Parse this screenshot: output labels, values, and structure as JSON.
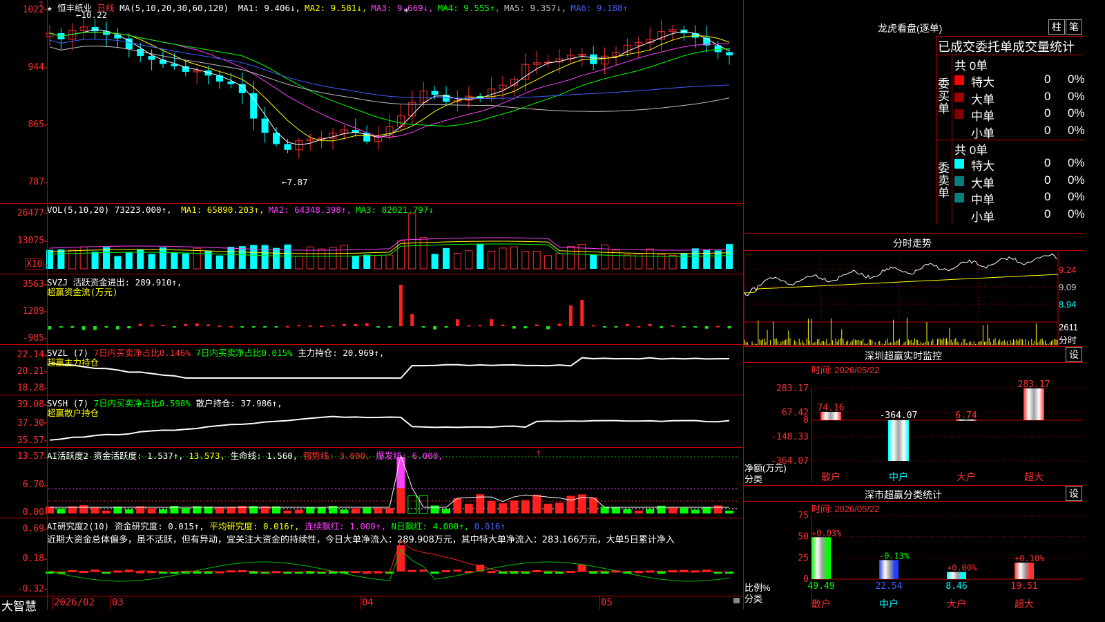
{
  "app": {
    "logo": "大智慧"
  },
  "main": {
    "title": "恒丰纸业",
    "period": "日线",
    "ma_label": "MA(5,10,20,30,60,120)",
    "ma": [
      {
        "name": "MA1:",
        "value": "9.406↓,",
        "color": "#ffffff"
      },
      {
        "name": "MA2:",
        "value": "9.581↓,",
        "color": "#ffff00"
      },
      {
        "name": "MA3:",
        "value": "9.669↓,",
        "color": "#ff40ff"
      },
      {
        "name": "MA4:",
        "value": "9.555↑,",
        "color": "#00ff00"
      },
      {
        "name": "MA5:",
        "value": "9.357↓,",
        "color": "#c0c0c0"
      },
      {
        "name": "MA6:",
        "value": "9.188↑",
        "color": "#4060ff"
      }
    ],
    "y_labels": [
      "1022",
      "944",
      "865",
      "787"
    ],
    "high_label": "10.22",
    "low_label": "7.87",
    "star_mark": "*"
  },
  "vol": {
    "header": "VOL(5,10,20) 73223.000↑,",
    "ma": [
      {
        "name": "MA1:",
        "value": "65890.203↑,",
        "color": "#ffff00"
      },
      {
        "name": "MA2:",
        "value": "64348.398↑,",
        "color": "#ff40ff"
      },
      {
        "name": "MA3:",
        "value": "82021.797↓",
        "color": "#00ff00"
      }
    ],
    "y_labels": [
      "26477",
      "13075"
    ],
    "unit": "X10"
  },
  "svzj": {
    "header": "SVZJ  活跃资金进出: 289.910↑,",
    "sub": "超赢资金流(万元)",
    "y_labels": [
      "3563",
      "1289",
      "-985"
    ]
  },
  "svzl": {
    "header_a": "SVZL (7)",
    "header_b": "7日内买卖净占比0.146%",
    "header_c": "7日内买卖净占比0.015%",
    "header_d": "主力持仓: 20.969↑,",
    "sub": "超赢主力持仓",
    "y_labels": [
      "22.14",
      "20.21",
      "18.28"
    ]
  },
  "svsh": {
    "header_a": "SVSH (7)",
    "header_b": "7日内买卖净占比0.598%",
    "header_c": "散户持仓: 37.986↑,",
    "sub": "超赢散户持仓",
    "y_labels": [
      "39.08",
      "37.30",
      "35.57"
    ]
  },
  "ai1": {
    "header_a": "AI活跃度2 资金活跃度: 1.537↑,",
    "header_b": "13.573,",
    "header_c": "生命线: 1.560,",
    "header_d": "强势线: 3.000,",
    "header_e": "爆发线: 6.000,",
    "arrow": "↑",
    "y_labels": [
      "13.57",
      "6.70",
      "0.00"
    ]
  },
  "ai2": {
    "header_a": "AI研究度2(10) 资金研究度: 0.015↑,",
    "header_b": "平均研究度: 0.016↑,",
    "header_c": "连续飘红: 1.000↑,",
    "header_d": "N日飘红: 4.000↑,",
    "header_e": "0.016↑",
    "comment": "近期大资金总体偏多，虽不活跃，但有异动，宜关注大资金的持续性，今日大单净流入：289.908万元，其中特大单净流入：283.166万元，大单5日累计净入",
    "y_labels": [
      "0.69",
      "0.18",
      "-0.32"
    ]
  },
  "xaxis": {
    "labels": [
      "2026/02",
      "03",
      "04",
      "05"
    ]
  },
  "right": {
    "lhb_title": "龙虎看盘(逐单)",
    "btn_zhu": "柱",
    "btn_bi": "笔",
    "tabs_title": "已成交委托单成交量统计",
    "buy": {
      "side": "委买单",
      "total": "共 0单",
      "rows": [
        {
          "label": "特大",
          "count": "0",
          "pct": "0%",
          "color": "#ff0000"
        },
        {
          "label": "大单",
          "count": "0",
          "pct": "0%",
          "color": "#a00000"
        },
        {
          "label": "中单",
          "count": "0",
          "pct": "0%",
          "color": "#800000"
        },
        {
          "label": "小单",
          "count": "0",
          "pct": "0%",
          "color": "#000000"
        }
      ]
    },
    "sell": {
      "side": "委卖单",
      "total": "共 0单",
      "rows": [
        {
          "label": "特大",
          "count": "0",
          "pct": "0%",
          "color": "#00ffff"
        },
        {
          "label": "大单",
          "count": "0",
          "pct": "0%",
          "color": "#008080"
        },
        {
          "label": "中单",
          "count": "0",
          "pct": "0%",
          "color": "#008080"
        },
        {
          "label": "小单",
          "count": "0",
          "pct": "0%",
          "color": "#000000"
        }
      ]
    },
    "intraday": {
      "title": "分时走势",
      "y_labels": [
        "9.24",
        "9.09",
        "8.94"
      ],
      "vol_label": "2611",
      "vol_sub": "分时"
    },
    "monitor": {
      "title": "深圳超赢实时监控",
      "settings": "设",
      "time": "时间: 2026/05/22",
      "y_labels": [
        "283.17",
        "67.42",
        "0",
        "-148.33",
        "-364.07"
      ],
      "y_axis_label": "净额(万元)",
      "x_axis_label": "分类",
      "categories": [
        "散户",
        "中户",
        "大户",
        "超大"
      ],
      "values": [
        "74.16",
        "-364.07",
        "6.74",
        "283.17"
      ]
    },
    "classify": {
      "title": "深市超赢分类统计",
      "settings": "设",
      "time": "时间: 2026/05/22",
      "y_labels": [
        "75",
        "50",
        "25",
        "0"
      ],
      "y_axis_label": "比例%",
      "x_axis_label": "分类",
      "categories": [
        "散户",
        "中户",
        "大户",
        "超大"
      ],
      "values": [
        "49.49",
        "22.54",
        "8.46",
        "19.51"
      ],
      "changes": [
        "+0.03%",
        "-0.13%",
        "+0.00%",
        "+0.10%"
      ]
    }
  }
}
